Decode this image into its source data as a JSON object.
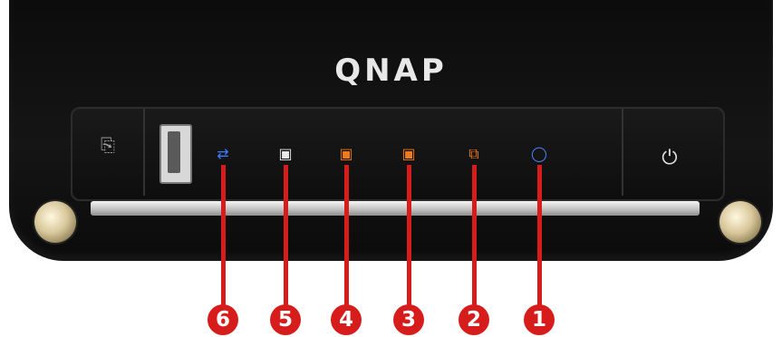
{
  "device": {
    "brand": "QNAP",
    "buttons": {
      "copy_icon": "copy-icon",
      "power_icon": "power-icon",
      "power_glyph": "⏻",
      "copy_glyph": "⎘"
    },
    "leds": [
      {
        "number": "6",
        "icon": "usb-icon",
        "glyph": "⇄",
        "color": "#3a7bff"
      },
      {
        "number": "5",
        "icon": "hdd-status-icon",
        "glyph": "▣",
        "color": "#e8e8e8"
      },
      {
        "number": "4",
        "icon": "hdd-icon",
        "glyph": "▣",
        "color": "#f07a18"
      },
      {
        "number": "3",
        "icon": "hdd-icon",
        "glyph": "▣",
        "color": "#f07a18"
      },
      {
        "number": "2",
        "icon": "lan-icon",
        "glyph": "⧉",
        "color": "#f07a18"
      },
      {
        "number": "1",
        "icon": "status-icon",
        "glyph": "◯",
        "color": "#4a82ff"
      }
    ]
  },
  "colors": {
    "callout_red": "#d71c1c",
    "chassis": "#121212"
  }
}
